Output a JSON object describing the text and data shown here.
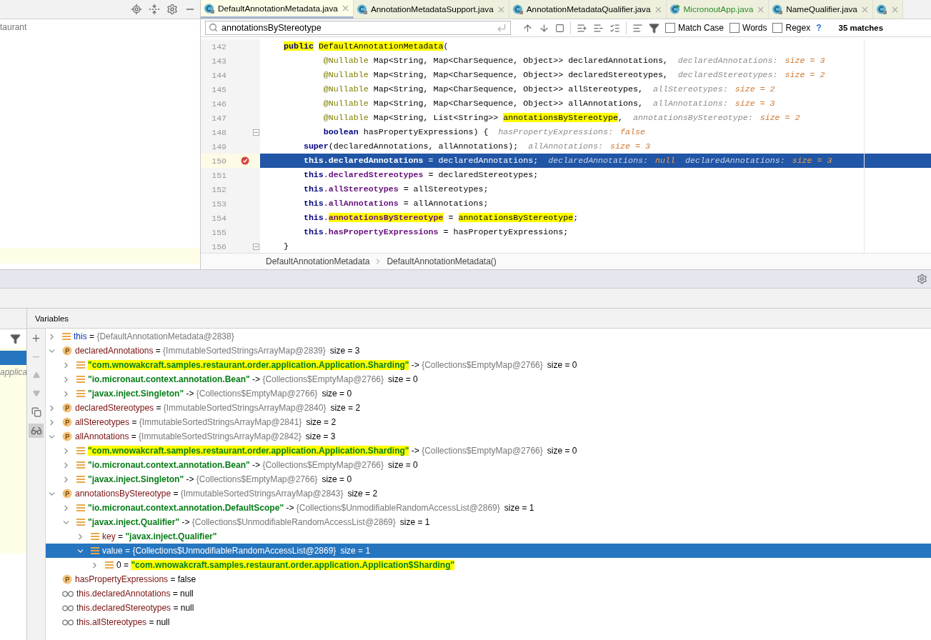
{
  "project_panel": {
    "rows": [
      {
        "label": "taurant",
        "selected": false
      },
      {
        "selected": true
      }
    ]
  },
  "editor_tabs": [
    {
      "label": "DefaultAnnotationMetadata.java",
      "kind": "class",
      "selected": true
    },
    {
      "label": "AnnotationMetadataSupport.java",
      "kind": "class",
      "selected": false
    },
    {
      "label": "AnnotationMetadataQualifier.java",
      "kind": "class",
      "selected": false
    },
    {
      "label": "MicronoutApp.java",
      "kind": "app",
      "selected": false
    },
    {
      "label": "NameQualifier.java",
      "kind": "class",
      "selected": false
    },
    {
      "kind": "class",
      "selected": false
    }
  ],
  "search": {
    "value": "annotationsByStereotype",
    "options": [
      {
        "label": "Match Case",
        "checked": false
      },
      {
        "label": "Words",
        "checked": false
      },
      {
        "label": "Regex",
        "checked": false
      }
    ],
    "help": "?",
    "matches": "35 matches"
  },
  "code_lines": [
    {
      "number": "142",
      "selected": false,
      "breakpoint": false,
      "fold": false,
      "tokens": [
        {
          "text": "    public",
          "kind": "kw",
          "marked": true
        },
        {
          "text": " DefaultAnnotationMetadata",
          "marked": true
        },
        {
          "text": "("
        }
      ]
    },
    {
      "number": "143",
      "selected": false,
      "breakpoint": false,
      "fold": false,
      "tokens": [
        {
          "text": "            @Nullable",
          "kind": "ann"
        },
        {
          "text": " Map<String, Map<CharSequence, Object>> declaredAnnotations,"
        },
        {
          "text": "declaredAnnotations:",
          "kind": "hint"
        },
        {
          "text": "size = 3",
          "kind": "hintval"
        }
      ]
    },
    {
      "number": "144",
      "selected": false,
      "breakpoint": false,
      "fold": false,
      "tokens": [
        {
          "text": "            @Nullable",
          "kind": "ann"
        },
        {
          "text": " Map<String, Map<CharSequence, Object>> declaredStereotypes,"
        },
        {
          "text": "declaredStereotypes:",
          "kind": "hint"
        },
        {
          "text": "size = 2",
          "kind": "hintval"
        }
      ]
    },
    {
      "number": "145",
      "selected": false,
      "breakpoint": false,
      "fold": false,
      "tokens": [
        {
          "text": "            @Nullable",
          "kind": "ann"
        },
        {
          "text": " Map<String, Map<CharSequence, Object>> allStereotypes,"
        },
        {
          "text": "allStereotypes:",
          "kind": "hint"
        },
        {
          "text": "size = 2",
          "kind": "hintval"
        }
      ]
    },
    {
      "number": "146",
      "selected": false,
      "breakpoint": false,
      "fold": false,
      "tokens": [
        {
          "text": "            @Nullable",
          "kind": "ann"
        },
        {
          "text": " Map<String, Map<CharSequence, Object>> allAnnotations,"
        },
        {
          "text": "allAnnotations:",
          "kind": "hint"
        },
        {
          "text": "size = 3",
          "kind": "hintval"
        }
      ]
    },
    {
      "number": "147",
      "selected": false,
      "breakpoint": false,
      "fold": false,
      "tokens": [
        {
          "text": "            @Nullable",
          "kind": "ann"
        },
        {
          "text": " Map<String, List<String>> "
        },
        {
          "text": "annotationsByStereotype",
          "marked": true
        },
        {
          "text": ","
        },
        {
          "text": "annotationsByStereotype:",
          "kind": "hint"
        },
        {
          "text": "size = 2",
          "kind": "hintval"
        }
      ]
    },
    {
      "number": "148",
      "selected": false,
      "breakpoint": false,
      "fold": true,
      "tokens": [
        {
          "text": "            boolean",
          "kind": "kw"
        },
        {
          "text": " hasPropertyExpressions) {"
        },
        {
          "text": "hasPropertyExpressions:",
          "kind": "hint"
        },
        {
          "text": "false",
          "kind": "hintval"
        }
      ]
    },
    {
      "number": "149",
      "selected": false,
      "breakpoint": false,
      "fold": false,
      "tokens": [
        {
          "text": "        super",
          "kind": "kw"
        },
        {
          "text": "(declaredAnnotations, allAnnotations);"
        },
        {
          "text": "allAnnotations:",
          "kind": "hint"
        },
        {
          "text": "size = 3",
          "kind": "hintval"
        }
      ]
    },
    {
      "number": "150",
      "selected": true,
      "breakpoint": true,
      "fold": false,
      "tokens": [
        {
          "text": "        this",
          "kind": "kw"
        },
        {
          "text": ".declaredAnnotations",
          "kind": "field"
        },
        {
          "text": " = declaredAnnotations;"
        },
        {
          "text": "declaredAnnotations:",
          "kind": "hint"
        },
        {
          "text": "null",
          "kind": "hintval"
        },
        {
          "text": "declaredAnnotations:",
          "kind": "hint"
        },
        {
          "text": "size = 3",
          "kind": "hintval"
        }
      ]
    },
    {
      "number": "151",
      "selected": false,
      "breakpoint": false,
      "fold": false,
      "tokens": [
        {
          "text": "        this",
          "kind": "kw"
        },
        {
          "text": ".declaredStereotypes",
          "kind": "field"
        },
        {
          "text": " = declaredStereotypes;"
        }
      ]
    },
    {
      "number": "152",
      "selected": false,
      "breakpoint": false,
      "fold": false,
      "tokens": [
        {
          "text": "        this",
          "kind": "kw"
        },
        {
          "text": ".allStereotypes",
          "kind": "field"
        },
        {
          "text": " = allStereotypes;"
        }
      ]
    },
    {
      "number": "153",
      "selected": false,
      "breakpoint": false,
      "fold": false,
      "tokens": [
        {
          "text": "        this",
          "kind": "kw"
        },
        {
          "text": ".allAnnotations",
          "kind": "field"
        },
        {
          "text": " = allAnnotations;"
        }
      ]
    },
    {
      "number": "154",
      "selected": false,
      "breakpoint": false,
      "fold": false,
      "tokens": [
        {
          "text": "        this",
          "kind": "kw"
        },
        {
          "text": ".",
          "kind": "field"
        },
        {
          "text": "annotationsByStereotype",
          "kind": "field",
          "marked": true
        },
        {
          "text": " = "
        },
        {
          "text": "annotationsByStereotype",
          "marked": true
        },
        {
          "text": ";"
        }
      ]
    },
    {
      "number": "155",
      "selected": false,
      "breakpoint": false,
      "fold": false,
      "tokens": [
        {
          "text": "        this",
          "kind": "kw"
        },
        {
          "text": ".hasPropertyExpressions",
          "kind": "field"
        },
        {
          "text": " = hasPropertyExpressions;"
        }
      ]
    },
    {
      "number": "156",
      "selected": false,
      "breakpoint": false,
      "fold": true,
      "tokens": [
        {
          "text": "    }"
        }
      ]
    }
  ],
  "breadcrumb": [
    "DefaultAnnotationMetadata",
    "DefaultAnnotationMetadata()"
  ],
  "frames": [
    {
      "selected": true
    },
    {
      "label": "applica",
      "selected": false
    }
  ],
  "variables": {
    "title": "Variables",
    "nodes": [
      {
        "kind": "entry",
        "expanded": false,
        "selected": false,
        "parts": [
          {
            "text": "this",
            "kind": "this"
          },
          {
            "text": " = ",
            "kind": "op"
          },
          {
            "text": "{DefaultAnnotationMetadata@2838}",
            "kind": "obj"
          }
        ]
      },
      {
        "kind": "field",
        "expanded": true,
        "selected": false,
        "parts": [
          {
            "text": "declaredAnnotations",
            "kind": "name"
          },
          {
            "text": " = ",
            "kind": "op"
          },
          {
            "text": "{ImmutableSortedStringsArrayMap@2839}",
            "kind": "obj"
          },
          {
            "text": "size = 3",
            "kind": "size"
          }
        ],
        "children": [
          {
            "kind": "entry",
            "expanded": false,
            "selected": false,
            "parts": [
              {
                "text": "\"com.wnowakcraft.samples.restaurant.order.application.Application.Sharding\"",
                "kind": "str",
                "marked": true
              },
              {
                "text": " -> ",
                "kind": "op"
              },
              {
                "text": "{Collections$EmptyMap@2766}",
                "kind": "obj"
              },
              {
                "text": "size = 0",
                "kind": "size"
              }
            ]
          },
          {
            "kind": "entry",
            "expanded": false,
            "selected": false,
            "parts": [
              {
                "text": "\"io.micronaut.context.annotation.Bean\"",
                "kind": "str"
              },
              {
                "text": " -> ",
                "kind": "op"
              },
              {
                "text": "{Collections$EmptyMap@2766}",
                "kind": "obj"
              },
              {
                "text": "size = 0",
                "kind": "size"
              }
            ]
          },
          {
            "kind": "entry",
            "expanded": false,
            "selected": false,
            "parts": [
              {
                "text": "\"javax.inject.Singleton\"",
                "kind": "str"
              },
              {
                "text": " -> ",
                "kind": "op"
              },
              {
                "text": "{Collections$EmptyMap@2766}",
                "kind": "obj"
              },
              {
                "text": "size = 0",
                "kind": "size"
              }
            ]
          }
        ]
      },
      {
        "kind": "field",
        "expanded": false,
        "selected": false,
        "parts": [
          {
            "text": "declaredStereotypes",
            "kind": "name"
          },
          {
            "text": " = ",
            "kind": "op"
          },
          {
            "text": "{ImmutableSortedStringsArrayMap@2840}",
            "kind": "obj"
          },
          {
            "text": "size = 2",
            "kind": "size"
          }
        ]
      },
      {
        "kind": "field",
        "expanded": false,
        "selected": false,
        "parts": [
          {
            "text": "allStereotypes",
            "kind": "name"
          },
          {
            "text": " = ",
            "kind": "op"
          },
          {
            "text": "{ImmutableSortedStringsArrayMap@2841}",
            "kind": "obj"
          },
          {
            "text": "size = 2",
            "kind": "size"
          }
        ]
      },
      {
        "kind": "field",
        "expanded": true,
        "selected": false,
        "parts": [
          {
            "text": "allAnnotations",
            "kind": "name"
          },
          {
            "text": " = ",
            "kind": "op"
          },
          {
            "text": "{ImmutableSortedStringsArrayMap@2842}",
            "kind": "obj"
          },
          {
            "text": "size = 3",
            "kind": "size"
          }
        ],
        "children": [
          {
            "kind": "entry",
            "expanded": false,
            "selected": false,
            "parts": [
              {
                "text": "\"com.wnowakcraft.samples.restaurant.order.application.Application.Sharding\"",
                "kind": "str",
                "marked": true
              },
              {
                "text": " -> ",
                "kind": "op"
              },
              {
                "text": "{Collections$EmptyMap@2766}",
                "kind": "obj"
              },
              {
                "text": "size = 0",
                "kind": "size"
              }
            ]
          },
          {
            "kind": "entry",
            "expanded": false,
            "selected": false,
            "parts": [
              {
                "text": "\"io.micronaut.context.annotation.Bean\"",
                "kind": "str"
              },
              {
                "text": " -> ",
                "kind": "op"
              },
              {
                "text": "{Collections$EmptyMap@2766}",
                "kind": "obj"
              },
              {
                "text": "size = 0",
                "kind": "size"
              }
            ]
          },
          {
            "kind": "entry",
            "expanded": false,
            "selected": false,
            "parts": [
              {
                "text": "\"javax.inject.Singleton\"",
                "kind": "str"
              },
              {
                "text": " -> ",
                "kind": "op"
              },
              {
                "text": "{Collections$EmptyMap@2766}",
                "kind": "obj"
              },
              {
                "text": "size = 0",
                "kind": "size"
              }
            ]
          }
        ]
      },
      {
        "kind": "field",
        "expanded": true,
        "selected": false,
        "parts": [
          {
            "text": "annotationsByStereotype",
            "kind": "name"
          },
          {
            "text": " = ",
            "kind": "op"
          },
          {
            "text": "{ImmutableSortedStringsArrayMap@2843}",
            "kind": "obj"
          },
          {
            "text": "size = 2",
            "kind": "size"
          }
        ],
        "children": [
          {
            "kind": "entry",
            "expanded": false,
            "selected": false,
            "parts": [
              {
                "text": "\"io.micronaut.context.annotation.DefaultScope\"",
                "kind": "str"
              },
              {
                "text": " -> ",
                "kind": "op"
              },
              {
                "text": "{Collections$UnmodifiableRandomAccessList@2869}",
                "kind": "obj"
              },
              {
                "text": "size = 1",
                "kind": "size"
              }
            ]
          },
          {
            "kind": "entry",
            "expanded": true,
            "selected": false,
            "parts": [
              {
                "text": "\"javax.inject.Qualifier\"",
                "kind": "str"
              },
              {
                "text": " -> ",
                "kind": "op"
              },
              {
                "text": "{Collections$UnmodifiableRandomAccessList@2869}",
                "kind": "obj"
              },
              {
                "text": "size = 1",
                "kind": "size"
              }
            ],
            "children": [
              {
                "kind": "entry",
                "expanded": false,
                "selected": false,
                "parts": [
                  {
                    "text": "key",
                    "kind": "name"
                  },
                  {
                    "text": " = ",
                    "kind": "op"
                  },
                  {
                    "text": "\"javax.inject.Qualifier\"",
                    "kind": "str"
                  }
                ]
              },
              {
                "kind": "entry",
                "expanded": true,
                "selected": true,
                "parts": [
                  {
                    "text": "value",
                    "kind": "name"
                  },
                  {
                    "text": " = ",
                    "kind": "op"
                  },
                  {
                    "text": "{Collections$UnmodifiableRandomAccessList@2869}",
                    "kind": "obj"
                  },
                  {
                    "text": "size = 1",
                    "kind": "size"
                  }
                ],
                "children": [
                  {
                    "kind": "entry",
                    "expanded": false,
                    "selected": false,
                    "parts": [
                      {
                        "text": "0",
                        "kind": "plain"
                      },
                      {
                        "text": " = ",
                        "kind": "op"
                      },
                      {
                        "text": "\"com.wnowakcraft.samples.restaurant.order.application.Application$Sharding\"",
                        "kind": "str",
                        "marked": true
                      }
                    ]
                  }
                ]
              }
            ]
          }
        ]
      },
      {
        "kind": "field",
        "selected": false,
        "parts": [
          {
            "text": "hasPropertyExpressions",
            "kind": "name"
          },
          {
            "text": " = ",
            "kind": "op"
          },
          {
            "text": "false",
            "kind": "plain"
          }
        ]
      },
      {
        "kind": "watch",
        "selected": false,
        "parts": [
          {
            "text": "this.declaredAnnotations",
            "kind": "name"
          },
          {
            "text": " = ",
            "kind": "op"
          },
          {
            "text": "null",
            "kind": "plain"
          }
        ]
      },
      {
        "kind": "watch",
        "selected": false,
        "parts": [
          {
            "text": "this.declaredStereotypes",
            "kind": "name"
          },
          {
            "text": " = ",
            "kind": "op"
          },
          {
            "text": "null",
            "kind": "plain"
          }
        ]
      },
      {
        "kind": "watch",
        "selected": false,
        "parts": [
          {
            "text": "this.allStereotypes",
            "kind": "name"
          },
          {
            "text": " = ",
            "kind": "op"
          },
          {
            "text": "null",
            "kind": "plain"
          }
        ]
      }
    ]
  }
}
